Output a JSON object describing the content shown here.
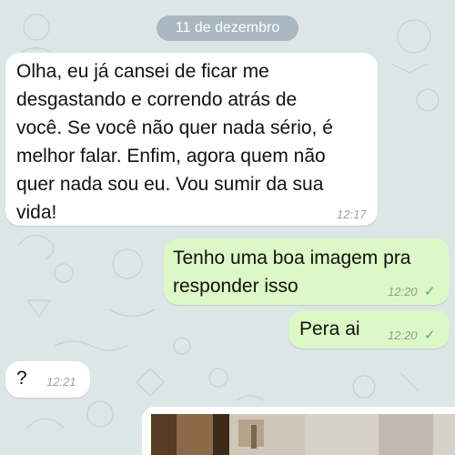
{
  "date_label": "11 de dezembro",
  "messages": [
    {
      "direction": "incoming",
      "text": "Olha, eu já cansei de ficar me\ndesgastando e correndo atrás de\nvocê. Se você não quer nada sério, é\nmelhor falar. Enfim, agora quem não\nquer nada sou eu. Vou sumir da sua\nvida!",
      "time": "12:17"
    },
    {
      "direction": "outgoing",
      "text": "Tenho uma boa imagem pra\nresponder isso",
      "time": "12:20",
      "status": "✓"
    },
    {
      "direction": "outgoing",
      "text": "Pera ai",
      "time": "12:20",
      "status": "✓"
    },
    {
      "direction": "incoming",
      "text": "?",
      "time": "12:21"
    }
  ],
  "colors": {
    "chat_background": "#dde6e7",
    "incoming_bubble": "#ffffff",
    "outgoing_bubble": "#dcf8c6",
    "date_pill": "#a9b7c0",
    "read_check": "#4fae5a"
  },
  "icons": {
    "status": "single-check-icon"
  }
}
